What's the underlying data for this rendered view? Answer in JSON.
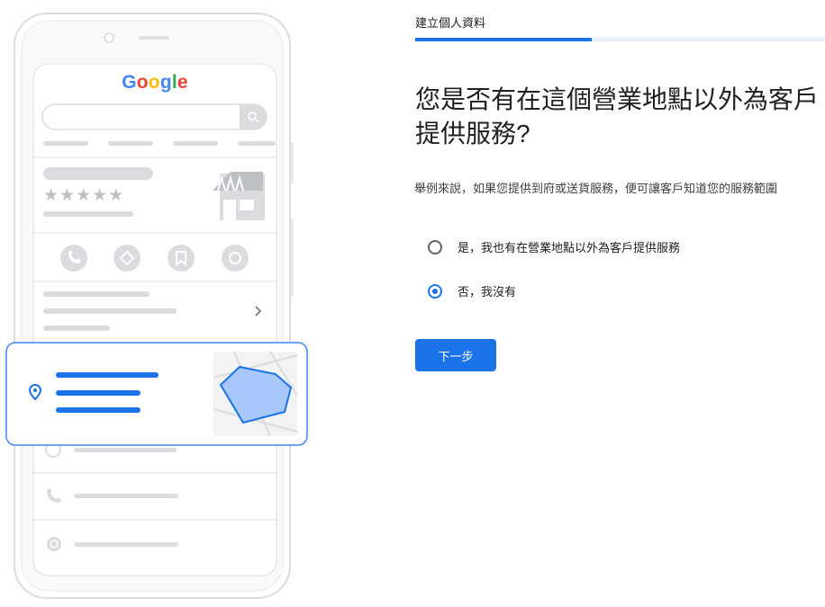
{
  "illustration": {
    "google_logo": "Google",
    "logo_colors": [
      "#4285f4",
      "#ea4335",
      "#fbbc05",
      "#4285f4",
      "#34a853",
      "#ea4335"
    ],
    "rating_stars": "★★★★★"
  },
  "header": {
    "step_title": "建立個人資料",
    "progress": 0.43
  },
  "question": {
    "title": "您是否有在這個營業地點以外為客戶提供服務?",
    "description": "舉例來說，如果您提供到府或送貨服務，便可讓客戶知道您的服務範圍"
  },
  "options": [
    {
      "label": "是，我也有在營業地點以外為客戶提供服務",
      "checked": false
    },
    {
      "label": "否，我沒有",
      "checked": true
    }
  ],
  "actions": {
    "next_label": "下一步"
  },
  "colors": {
    "accent": "#1a73e8",
    "progress_track": "#e8f0fe"
  }
}
